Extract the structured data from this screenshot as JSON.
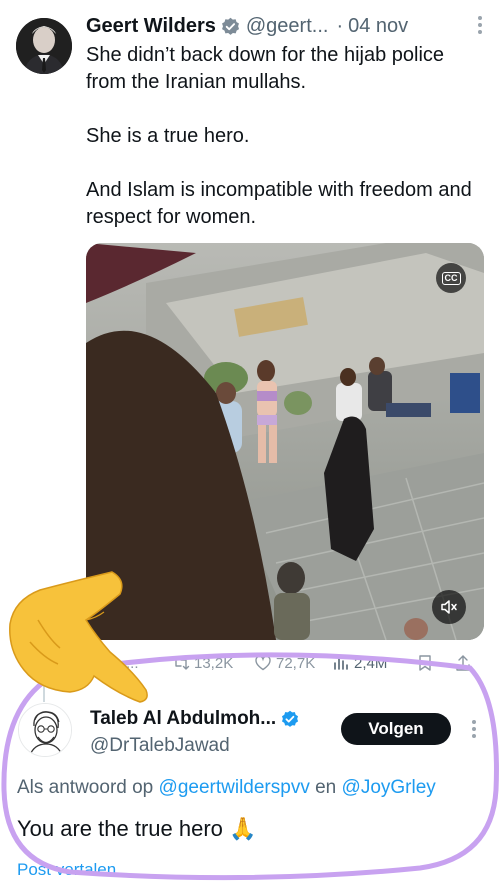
{
  "tweet": {
    "author_name": "Geert Wilders",
    "author_handle": "@geert...",
    "separator": "·",
    "date": "04 nov",
    "paragraphs": [
      "She didn’t back down for the hijab police from the Iranian mullahs.",
      "She is a true hero.",
      "And Islam is incompatible with freedom and respect for women."
    ],
    "media": {
      "cc_label": "CC"
    },
    "stats": {
      "replies": "...",
      "reposts": "13,2K",
      "likes": "72,7K",
      "views": "2,4M"
    }
  },
  "reply": {
    "author_name": "Taleb Al Abdulmoh...",
    "author_handle": "@DrTalebJawad",
    "follow_label": "Volgen",
    "reply_prefix": "Als antwoord op",
    "mention_1": "@geertwilderspvv",
    "conjunction": "en",
    "mention_2": "@JoyGrley",
    "text": "You are the true hero 🙏",
    "translate_label": "Post vertalen"
  },
  "colors": {
    "accent": "#1d9bf0",
    "highlight_circle": "#c8a2f0",
    "text_primary": "#0f1419",
    "text_secondary": "#536471"
  },
  "icons": [
    "verified-badge-icon",
    "more-icon",
    "cc-icon",
    "mute-icon",
    "reply-icon",
    "repost-icon",
    "like-icon",
    "views-icon",
    "bookmark-icon",
    "share-icon",
    "pointing-hand-emoji"
  ]
}
